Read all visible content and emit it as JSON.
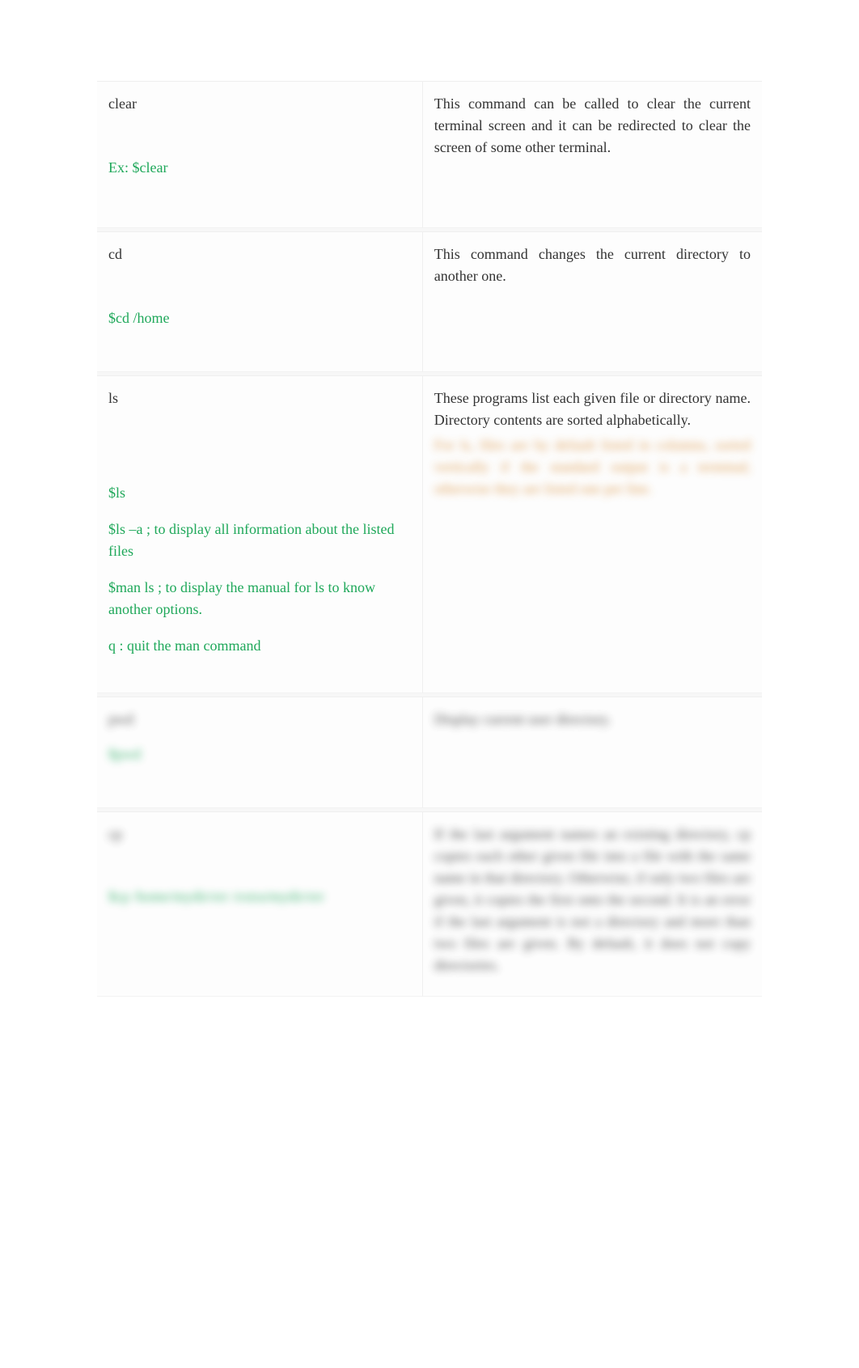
{
  "rows": [
    {
      "command": "clear",
      "example_spaced": "Ex: $clear",
      "description": "This command can be called to clear the current terminal screen and it can be redirected to clear the screen of some other terminal."
    },
    {
      "command": "cd",
      "example_spaced": "$cd /home",
      "description": "This command changes the current directory to another one."
    },
    {
      "command": "ls",
      "examples": [
        "$ls",
        "$ls –a ; to display all information about the listed files",
        "$man ls ; to display the manual for  ls to know another options.",
        "q : quit the man command"
      ],
      "description": "These programs list each given file or directory name. Directory contents are sorted alphabetically.",
      "blurred_desc": "For ls, files are by default listed in columns, sorted vertically if the standard output is a terminal; otherwise they are listed one per line."
    },
    {
      "command_blurred": "pwd",
      "example_blurred": "$pwd",
      "description_blurred": "Display current user directory."
    },
    {
      "command_blurred": "cp",
      "example_blurred": "$cp /home/mydir/err /extra/mydir/err",
      "description_blurred": "If the last argument names an existing directory, cp copies each other given file into a file with the same name in that directory. Otherwise, if only two files are given, it copies the first onto the second. It is an error if the last argument is not a directory and more than two files are given. By default, it does not copy directories."
    }
  ]
}
